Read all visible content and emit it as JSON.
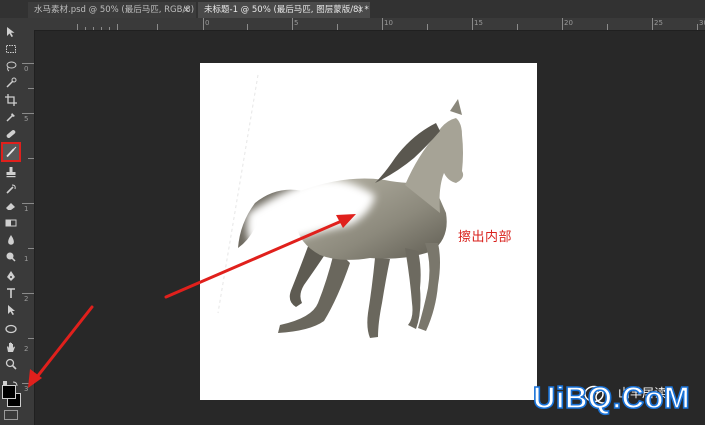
{
  "tabs": [
    {
      "label": "水马素材.psd @ 50% (最后马匹, RGB/8) *",
      "close": "×"
    },
    {
      "label": "未标题-1 @ 50% (最后马匹, 图层蒙版/8) *",
      "close": "×"
    }
  ],
  "ruler_top_ticks": [
    "0",
    "5",
    "10",
    "15",
    "20",
    "25",
    "30"
  ],
  "ruler_left_ticks": [
    "0",
    "5",
    "1",
    "1",
    "2",
    "2",
    "3"
  ],
  "annotation": "擦出内部",
  "watermark": {
    "text": "山羊居读",
    "logo": "UiBQ.CoM"
  },
  "colors": {
    "highlight": "#e0201c",
    "annotation": "#d9221d",
    "foreground_swatch": "#000000",
    "background_swatch": "#ffffff"
  },
  "toolbar_icons": [
    "move-tool-icon",
    "marquee-tool-icon",
    "lasso-tool-icon",
    "quick-selection-tool-icon",
    "crop-tool-icon",
    "eyedropper-tool-icon",
    "healing-brush-tool-icon",
    "brush-tool-icon",
    "clone-stamp-tool-icon",
    "history-brush-tool-icon",
    "eraser-tool-icon",
    "gradient-tool-icon",
    "blur-tool-icon",
    "dodge-tool-icon",
    "pen-tool-icon",
    "type-tool-icon",
    "path-selection-tool-icon",
    "ellipse-tool-icon",
    "hand-tool-icon",
    "zoom-tool-icon"
  ]
}
